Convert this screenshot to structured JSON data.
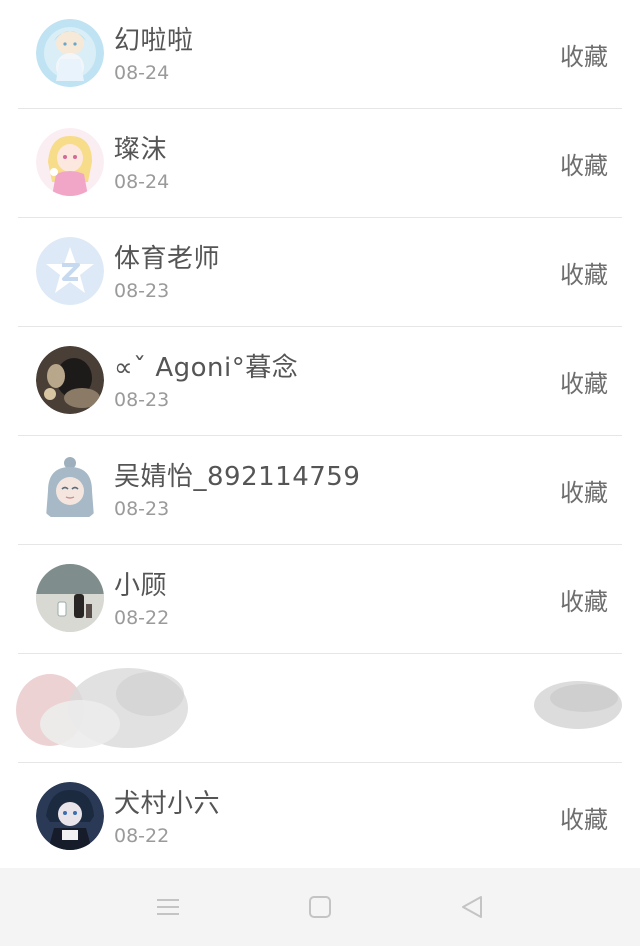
{
  "items": [
    {
      "name": "幻啦啦",
      "date": "08-24",
      "action": "收藏",
      "avatar": "pastel-anime-girl-avatar"
    },
    {
      "name": "璨沫",
      "date": "08-24",
      "action": "收藏",
      "avatar": "pink-anime-girl-avatar"
    },
    {
      "name": "体育老师",
      "date": "08-23",
      "action": "收藏",
      "avatar": "qq-default-avatar"
    },
    {
      "name": "∝ˇ  Agoni°暮念",
      "date": "08-23",
      "action": "收藏",
      "avatar": "dark-photo-avatar"
    },
    {
      "name": "吴婧怡_892114759",
      "date": "08-23",
      "action": "收藏",
      "avatar": "chibi-girl-avatar"
    },
    {
      "name": "小顾",
      "date": "08-22",
      "action": "收藏",
      "avatar": "room-photo-avatar"
    },
    {
      "name": "犬村小六",
      "date": "08-22",
      "action": "收藏",
      "avatar": "dark-anime-avatar"
    }
  ],
  "navbar": {
    "menu_icon": "menu-icon",
    "home_icon": "home-square-icon",
    "back_icon": "back-triangle-icon"
  },
  "colors": {
    "name_text": "#555555",
    "date_text": "#9a9a9a",
    "action_text": "#6e6e6e",
    "divider": "#e6e6e6",
    "navbar_bg": "#f4f4f4",
    "nav_icon": "#c4c4c4"
  }
}
